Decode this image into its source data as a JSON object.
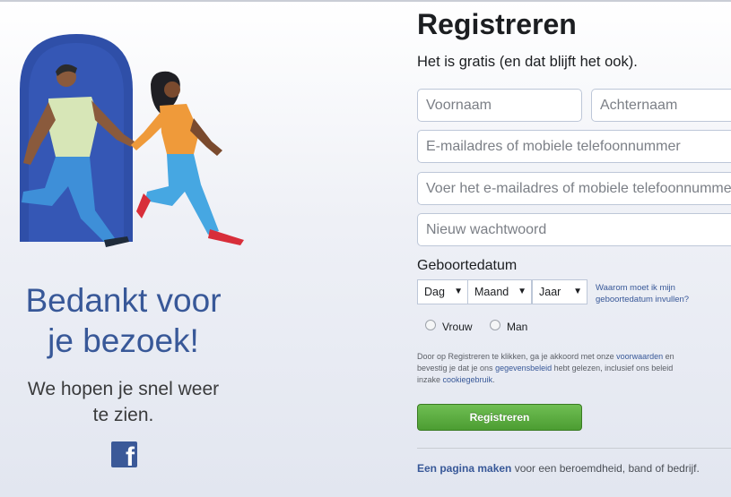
{
  "left": {
    "thanks_title_line1": "Bedankt voor",
    "thanks_title_line2": "je bezoek!",
    "thanks_sub_line1": "We hopen je snel weer",
    "thanks_sub_line2": "te zien.",
    "logo_glyph": "f",
    "illustration": "two-people-walking-through-doorway"
  },
  "form": {
    "title": "Registreren",
    "subtitle": "Het is gratis (en dat blijft het ook).",
    "first_name_placeholder": "Voornaam",
    "last_name_placeholder": "Achternaam",
    "email_placeholder": "E-mailadres of mobiele telefoonnummer",
    "email_confirm_placeholder": "Voer het e-mailadres of mobiele telefoonnummer opnieuw in",
    "password_placeholder": "Nieuw wachtwoord",
    "birthday_label": "Geboortedatum",
    "day_label": "Dag",
    "month_label": "Maand",
    "year_label": "Jaar",
    "dropdown_arrow": "▼",
    "why_birthday": "Waarom moet ik mijn geboortedatum invullen?",
    "gender_female": "Vrouw",
    "gender_male": "Man",
    "terms_part1": "Door op Registreren te klikken, ga je akkoord met onze ",
    "terms_link_terms": "voorwaarden",
    "terms_part2": " en bevestig je dat je ons ",
    "terms_link_data": "gegevensbeleid",
    "terms_part3": " hebt gelezen, inclusief ons beleid inzake ",
    "terms_link_cookie": "cookiegebruik",
    "terms_part4": ".",
    "submit_label": "Registreren"
  },
  "footer": {
    "create_page_link": "Een pagina maken",
    "create_page_rest": " voor een beroemdheid, band of bedrijf."
  },
  "colors": {
    "brand_blue": "#3b5998",
    "link_blue": "#385898",
    "button_green": "#5cad41",
    "title_blue": "#385898"
  }
}
